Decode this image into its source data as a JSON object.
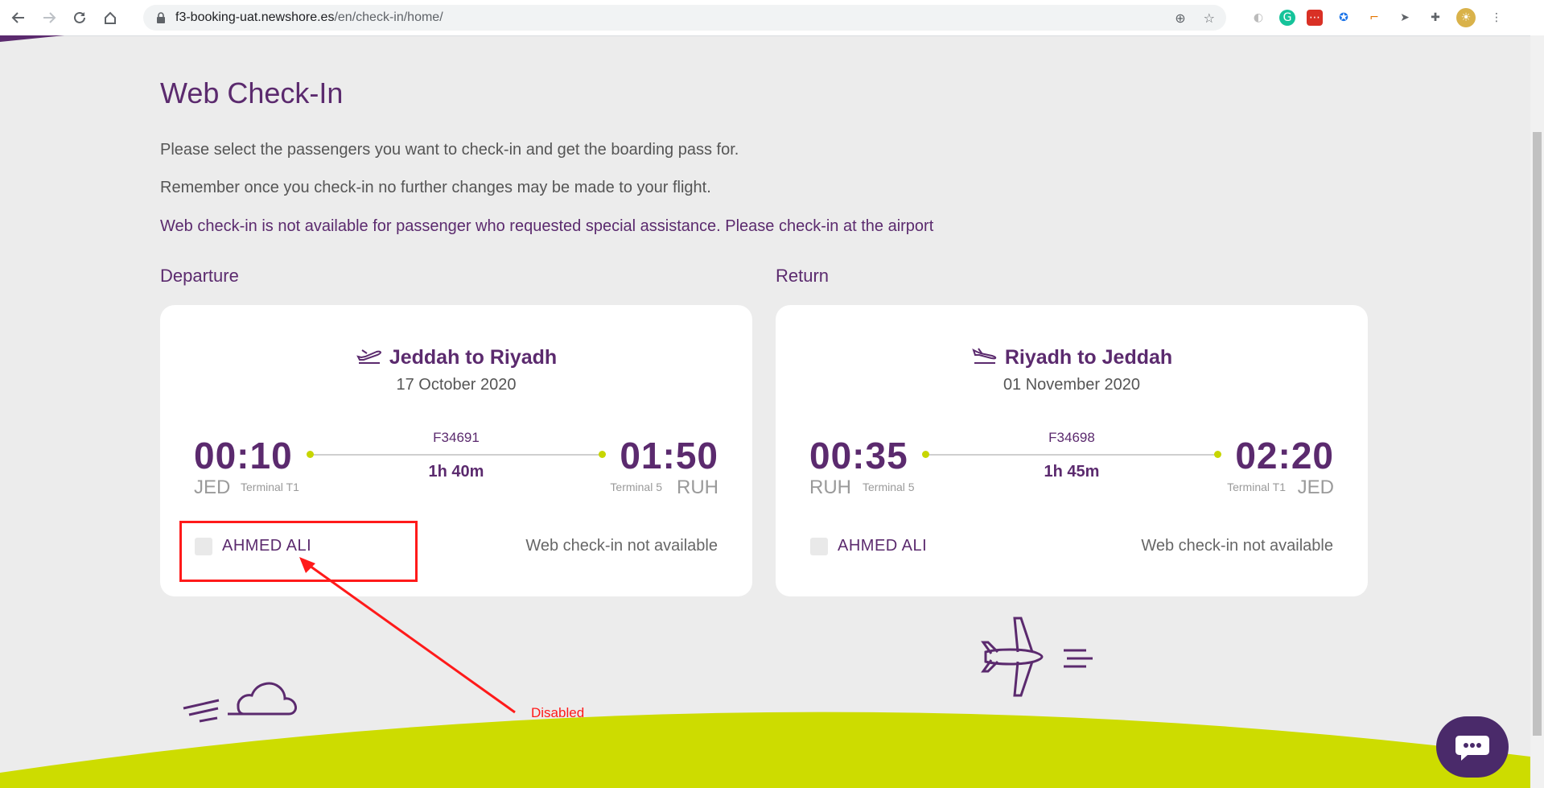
{
  "browser": {
    "url_domain": "f3-booking-uat.newshore.es",
    "url_path": "/en/check-in/home/"
  },
  "page": {
    "title": "Web Check-In",
    "intro_1": "Please select the passengers you want to check-in and get the boarding pass for.",
    "intro_2": "Remember once you check-in no further changes may be made to your flight.",
    "intro_3": "Web check-in is not available for passenger who requested special assistance. Please check-in at the airport"
  },
  "departure": {
    "label": "Departure",
    "route": "Jeddah to Riyadh",
    "date": "17 October 2020",
    "dep_time": "00:10",
    "dep_code": "JED",
    "dep_terminal": "Terminal T1",
    "flight_no": "F34691",
    "duration": "1h 40m",
    "arr_time": "01:50",
    "arr_code": "RUH",
    "arr_terminal": "Terminal 5",
    "passenger": "AHMED ALI",
    "status": "Web check-in not available"
  },
  "return": {
    "label": "Return",
    "route": "Riyadh to Jeddah",
    "date": "01 November 2020",
    "dep_time": "00:35",
    "dep_code": "RUH",
    "dep_terminal": "Terminal 5",
    "flight_no": "F34698",
    "duration": "1h 45m",
    "arr_time": "02:20",
    "arr_code": "JED",
    "arr_terminal": "Terminal T1",
    "passenger": "AHMED ALI",
    "status": "Web check-in not available"
  },
  "annotation": {
    "text": "Disabled"
  },
  "colors": {
    "brand_purple": "#5b2a6e",
    "brand_lime": "#cddc00",
    "annotation_red": "#ff1a1a"
  }
}
